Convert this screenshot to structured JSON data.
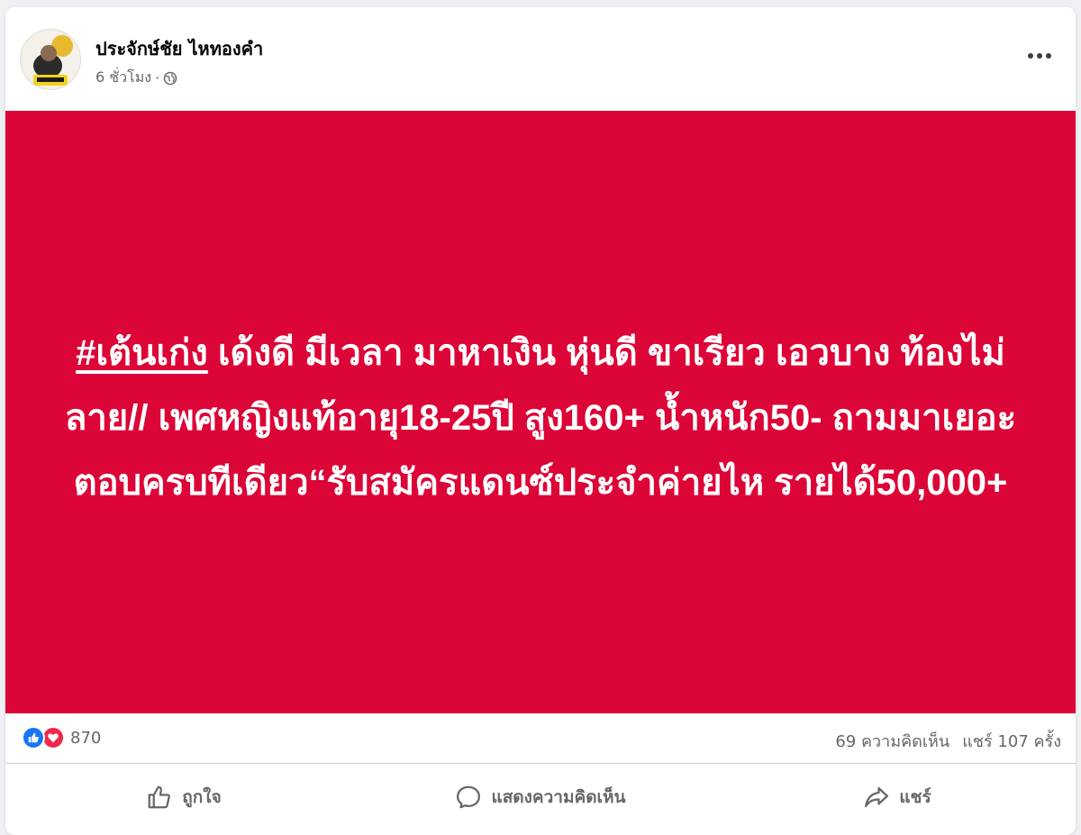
{
  "post": {
    "author": "ประจักษ์ชัย ไหทองคำ",
    "time": "6 ชั่วโมง",
    "separator": "·",
    "privacy_icon": "globe-icon",
    "more_icon": "more-options-icon"
  },
  "banner": {
    "background": "#dc0537",
    "hashtag": "#เต้นเก่ง",
    "text": " เด้งดี มีเวลา มาหาเงิน หุ่นดี ขาเรียว เอวบาง ท้องไม่ลาย// เพศหญิงแท้อายุ18-25ปี สูง160+ น้ำหนัก50- ถามมาเยอะตอบครบทีเดียว“รับสมัครแดนซ์ประจำค่ายไห รายได้50,000+"
  },
  "stats": {
    "reaction_icons": [
      "like-icon",
      "love-icon"
    ],
    "reaction_count": "870",
    "comments": "69 ความคิดเห็น",
    "shares": "แชร์ 107 ครั้ง"
  },
  "actions": {
    "like": "ถูกใจ",
    "comment": "แสดงความคิดเห็น",
    "share": "แชร์"
  }
}
